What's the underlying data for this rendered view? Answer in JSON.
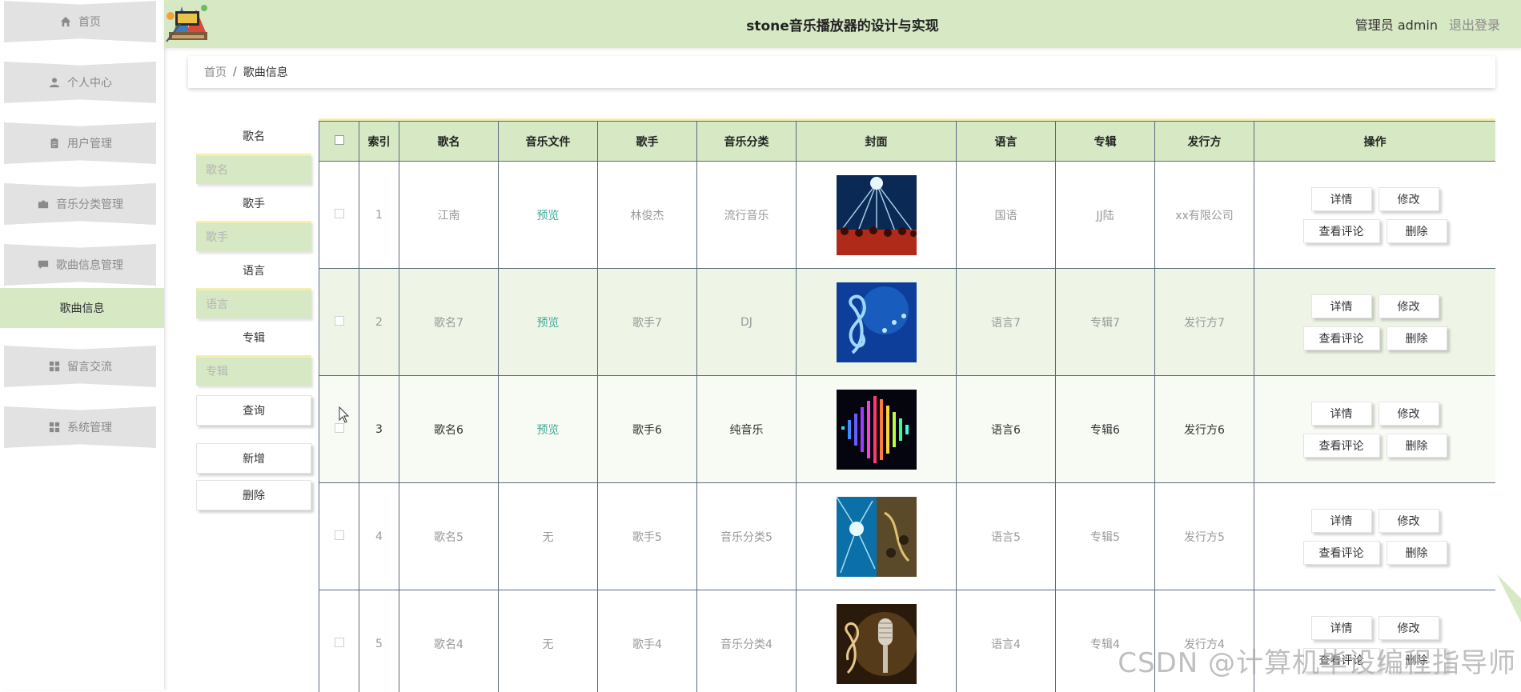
{
  "sidebar": {
    "items": [
      {
        "label": "首页",
        "icon": "home-icon"
      },
      {
        "label": "个人中心",
        "icon": "user-icon"
      },
      {
        "label": "用户管理",
        "icon": "clipboard-icon"
      },
      {
        "label": "音乐分类管理",
        "icon": "folder-icon"
      },
      {
        "label": "歌曲信息管理",
        "icon": "chat-icon"
      },
      {
        "label": "留言交流",
        "icon": "grid-icon"
      },
      {
        "label": "系统管理",
        "icon": "grid-icon"
      }
    ],
    "active_sub": "歌曲信息"
  },
  "header": {
    "title": "stone音乐播放器的设计与实现",
    "user": "管理员 admin",
    "logout": "退出登录"
  },
  "breadcrumb": {
    "home": "首页",
    "sep": "/",
    "current": "歌曲信息"
  },
  "search": {
    "song_label": "歌名",
    "song_placeholder": "歌名",
    "singer_label": "歌手",
    "singer_placeholder": "歌手",
    "lang_label": "语言",
    "lang_placeholder": "语言",
    "album_label": "专辑",
    "album_placeholder": "专辑",
    "query": "查询",
    "add": "新增",
    "delete": "删除"
  },
  "table": {
    "headers": [
      "索引",
      "歌名",
      "音乐文件",
      "歌手",
      "音乐分类",
      "封面",
      "语言",
      "专辑",
      "发行方",
      "操作"
    ],
    "rows": [
      {
        "idx": "1",
        "name": "江南",
        "file": "预览",
        "singer": "林俊杰",
        "category": "流行音乐",
        "lang": "国语",
        "album": "JJ陆",
        "publisher": "xx有限公司"
      },
      {
        "idx": "2",
        "name": "歌名7",
        "file": "预览",
        "singer": "歌手7",
        "category": "DJ",
        "lang": "语言7",
        "album": "专辑7",
        "publisher": "发行方7"
      },
      {
        "idx": "3",
        "name": "歌名6",
        "file": "预览",
        "singer": "歌手6",
        "category": "纯音乐",
        "lang": "语言6",
        "album": "专辑6",
        "publisher": "发行方6"
      },
      {
        "idx": "4",
        "name": "歌名5",
        "file": "无",
        "singer": "歌手5",
        "category": "音乐分类5",
        "lang": "语言5",
        "album": "专辑5",
        "publisher": "发行方5"
      },
      {
        "idx": "5",
        "name": "歌名4",
        "file": "无",
        "singer": "歌手4",
        "category": "音乐分类4",
        "lang": "语言4",
        "album": "专辑4",
        "publisher": "发行方4"
      }
    ],
    "actions": {
      "detail": "详情",
      "edit": "修改",
      "comments": "查看评论",
      "remove": "删除"
    }
  },
  "watermark": "CSDN @计算机毕设编程指导师",
  "colors": {
    "accent": "#d6e8c4",
    "link": "#3fa79a",
    "input_top_border": "#f4efae"
  }
}
